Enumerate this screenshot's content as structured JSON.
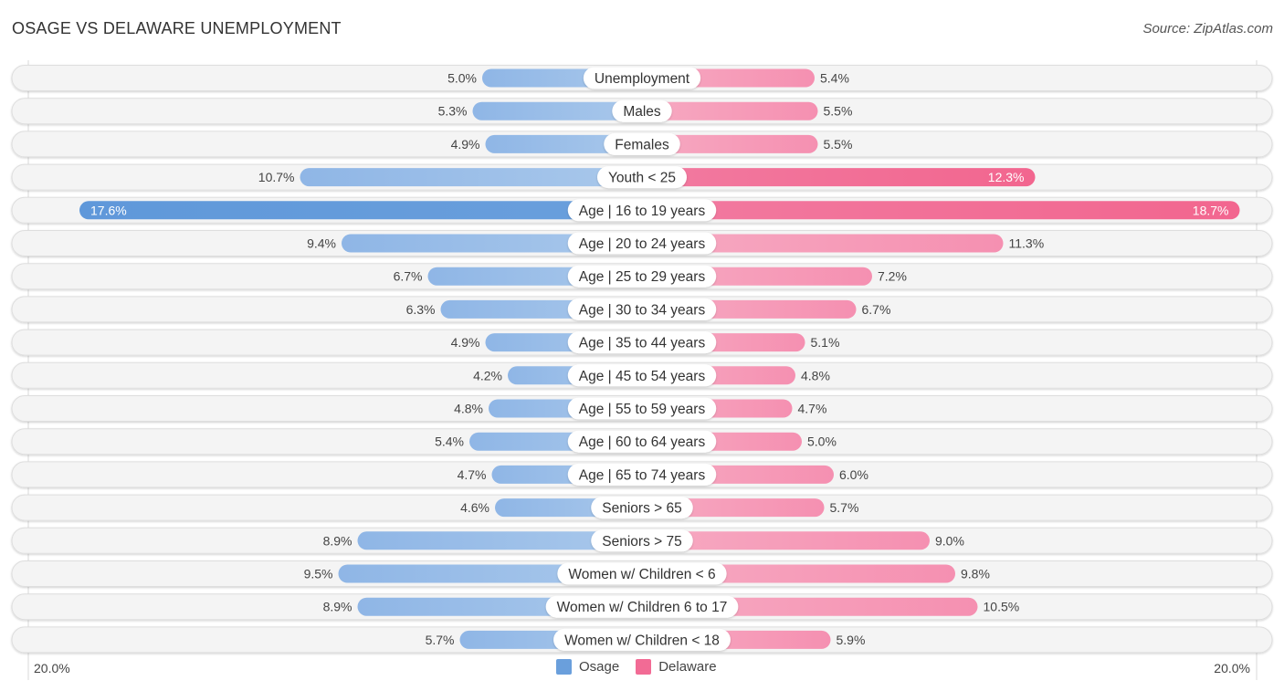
{
  "header": {
    "title": "OSAGE VS DELAWARE UNEMPLOYMENT",
    "source": "Source: ZipAtlas.com"
  },
  "colors": {
    "osage": "#6a9fdc",
    "osage_light": "#a7c6ea",
    "delaware": "#f26b95",
    "delaware_light": "#f6a7c0",
    "row_bg": "#f3f3f3"
  },
  "chart_data": {
    "type": "bar",
    "orientation": "horizontal-diverging",
    "title": "OSAGE VS DELAWARE UNEMPLOYMENT",
    "xlabel": "",
    "ylabel": "",
    "xlim": [
      -20,
      20
    ],
    "axis_labels": {
      "left": "20.0%",
      "right": "20.0%"
    },
    "legend": {
      "position": "bottom-center",
      "entries": [
        "Osage",
        "Delaware"
      ]
    },
    "categories": [
      "Unemployment",
      "Males",
      "Females",
      "Youth < 25",
      "Age | 16 to 19 years",
      "Age | 20 to 24 years",
      "Age | 25 to 29 years",
      "Age | 30 to 34 years",
      "Age | 35 to 44 years",
      "Age | 45 to 54 years",
      "Age | 55 to 59 years",
      "Age | 60 to 64 years",
      "Age | 65 to 74 years",
      "Seniors > 65",
      "Seniors > 75",
      "Women w/ Children < 6",
      "Women w/ Children 6 to 17",
      "Women w/ Children < 18"
    ],
    "series": [
      {
        "name": "Osage",
        "side": "left",
        "values": [
          5.0,
          5.3,
          4.9,
          10.7,
          17.6,
          9.4,
          6.7,
          6.3,
          4.9,
          4.2,
          4.8,
          5.4,
          4.7,
          4.6,
          8.9,
          9.5,
          8.9,
          5.7
        ],
        "labels": [
          "5.0%",
          "5.3%",
          "4.9%",
          "10.7%",
          "17.6%",
          "9.4%",
          "6.7%",
          "6.3%",
          "4.9%",
          "4.2%",
          "4.8%",
          "5.4%",
          "4.7%",
          "4.6%",
          "8.9%",
          "9.5%",
          "8.9%",
          "5.7%"
        ]
      },
      {
        "name": "Delaware",
        "side": "right",
        "values": [
          5.4,
          5.5,
          5.5,
          12.3,
          18.7,
          11.3,
          7.2,
          6.7,
          5.1,
          4.8,
          4.7,
          5.0,
          6.0,
          5.7,
          9.0,
          9.8,
          10.5,
          5.9
        ],
        "labels": [
          "5.4%",
          "5.5%",
          "5.5%",
          "12.3%",
          "18.7%",
          "11.3%",
          "7.2%",
          "6.7%",
          "5.1%",
          "4.8%",
          "4.7%",
          "5.0%",
          "6.0%",
          "5.7%",
          "9.0%",
          "9.8%",
          "10.5%",
          "5.9%"
        ]
      }
    ]
  }
}
